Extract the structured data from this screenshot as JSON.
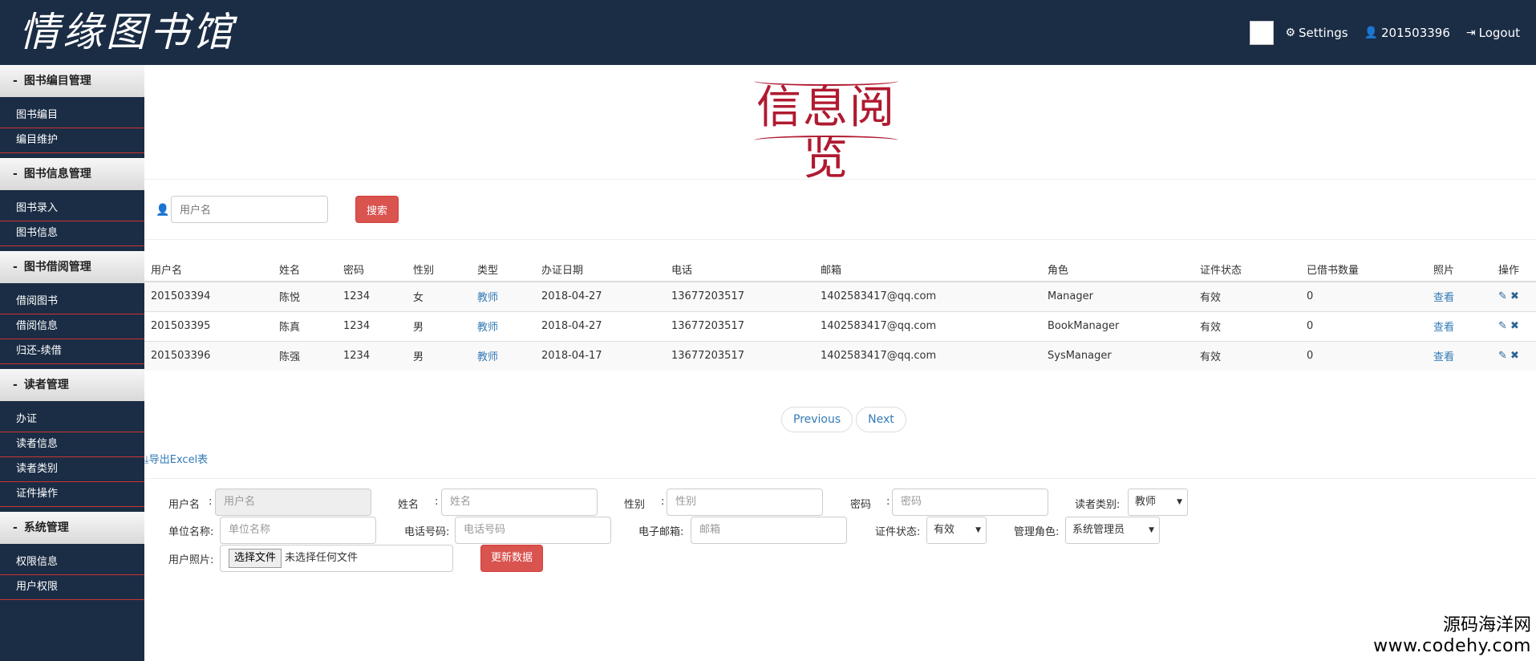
{
  "header": {
    "logo_text": "情缘图书馆",
    "settings_label": "Settings",
    "user_label": "201503396",
    "logout_label": "Logout"
  },
  "sidebar": {
    "groups": [
      {
        "title": "图书编目管理",
        "items": [
          "图书编目",
          "编目维护"
        ]
      },
      {
        "title": "图书信息管理",
        "items": [
          "图书录入",
          "图书信息"
        ]
      },
      {
        "title": "图书借阅管理",
        "items": [
          "借阅图书",
          "借阅信息",
          "归还-续借"
        ]
      },
      {
        "title": "读者管理",
        "items": [
          "办证",
          "读者信息",
          "读者类别",
          "证件操作"
        ]
      },
      {
        "title": "系统管理",
        "items": [
          "权限信息",
          "用户权限"
        ]
      }
    ]
  },
  "banner": {
    "title": "信息阅览"
  },
  "search": {
    "placeholder": "用户名",
    "button": "搜索"
  },
  "table": {
    "headers": [
      "用户名",
      "姓名",
      "密码",
      "性别",
      "类型",
      "办证日期",
      "电话",
      "邮箱",
      "角色",
      "证件状态",
      "已借书数量",
      "照片",
      "操作"
    ],
    "rows": [
      [
        "201503394",
        "陈悦",
        "1234",
        "女",
        "教师",
        "2018-04-27",
        "13677203517",
        "1402583417@qq.com",
        "Manager",
        "有效",
        "0",
        "查看"
      ],
      [
        "201503395",
        "陈真",
        "1234",
        "男",
        "教师",
        "2018-04-27",
        "13677203517",
        "1402583417@qq.com",
        "BookManager",
        "有效",
        "0",
        "查看"
      ],
      [
        "201503396",
        "陈强",
        "1234",
        "男",
        "教师",
        "2018-04-17",
        "13677203517",
        "1402583417@qq.com",
        "SysManager",
        "有效",
        "0",
        "查看"
      ]
    ]
  },
  "pager": {
    "previous": "Previous",
    "next": "Next"
  },
  "export_label": "导出Excel表",
  "form": {
    "username_label": "用户名",
    "username_ph": "用户名",
    "name_label": "姓名",
    "name_ph": "姓名",
    "gender_label": "性别",
    "gender_ph": "性别",
    "password_label": "密码",
    "password_ph": "密码",
    "reader_type_label": "读者类别:",
    "reader_type_value": "教师",
    "unit_label": "单位名称:",
    "unit_ph": "单位名称",
    "phone_label": "电话号码:",
    "phone_ph": "电话号码",
    "email_label": "电子邮箱:",
    "email_ph": "邮箱",
    "cert_status_label": "证件状态:",
    "cert_status_value": "有效",
    "role_label": "管理角色:",
    "role_value": "系统管理员",
    "photo_label": "用户照片:",
    "file_button": "选择文件",
    "file_status": "未选择任何文件",
    "update_button": "更新数据"
  },
  "watermark": {
    "line1": "源码海洋网",
    "line2": "www.codehy.com"
  }
}
